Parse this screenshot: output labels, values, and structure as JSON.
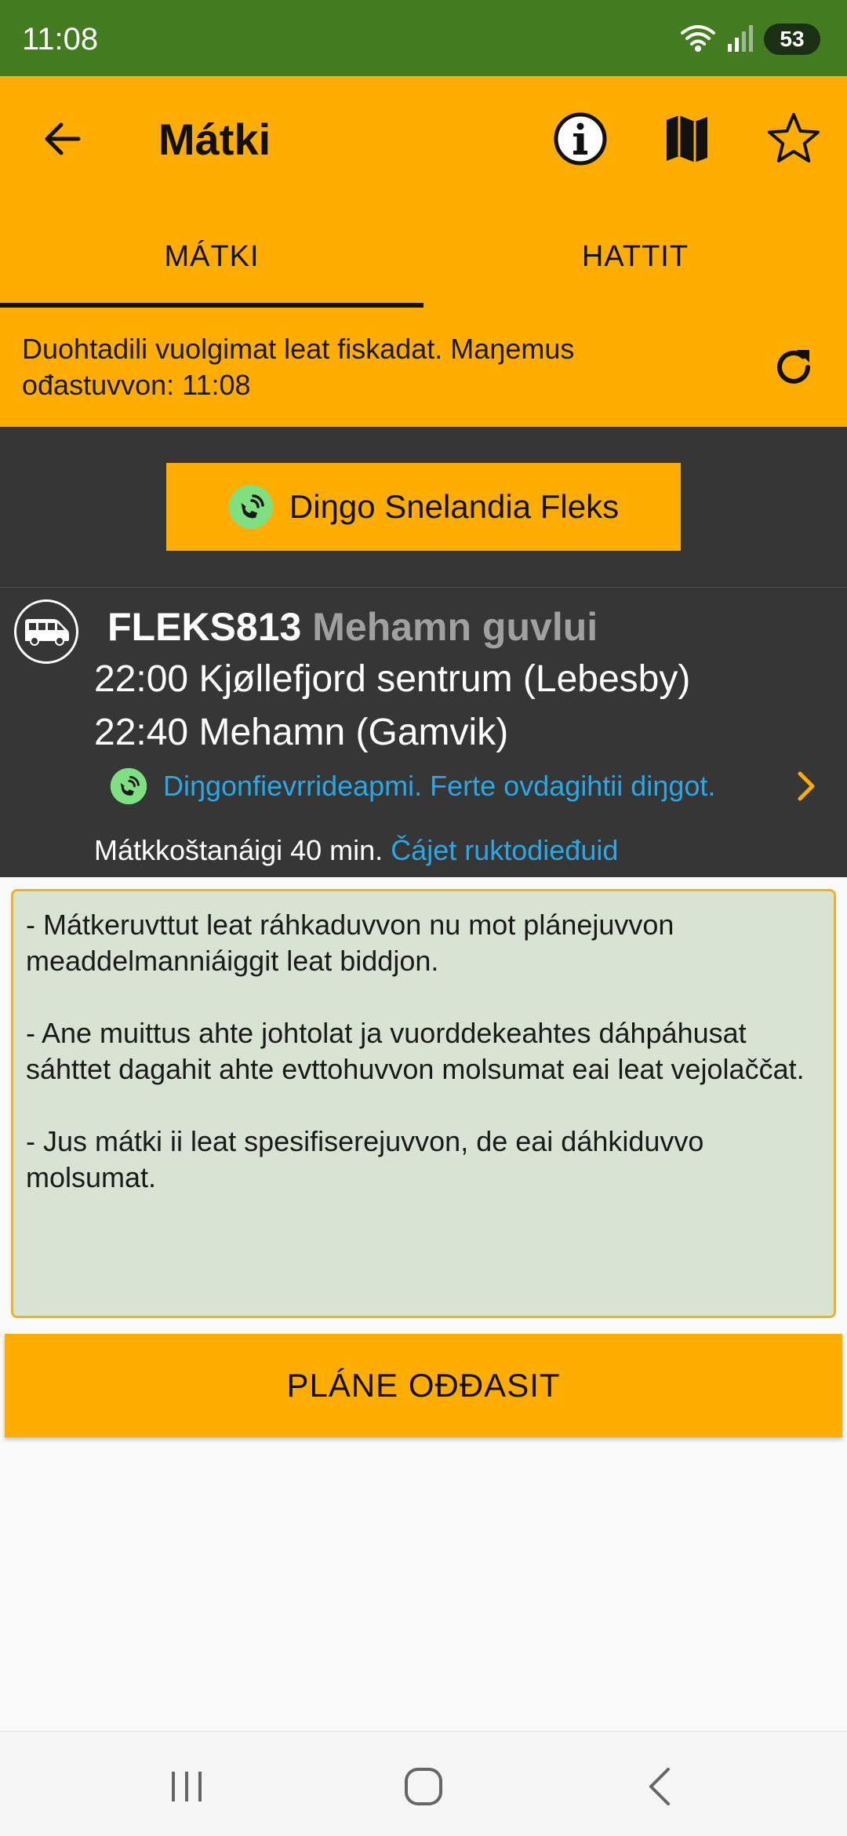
{
  "status_bar": {
    "time": "11:08",
    "battery": "53",
    "icons": [
      "wifi-icon",
      "signal-icon",
      "battery-icon"
    ]
  },
  "app_bar": {
    "title": "Mátki",
    "icons": [
      "back-arrow-icon",
      "info-icon",
      "map-icon",
      "star-icon"
    ]
  },
  "tabs": [
    {
      "label": "MÁTKI",
      "active": true
    },
    {
      "label": "HATTIT",
      "active": false
    }
  ],
  "realtime": {
    "message": "Duohtadili vuolgimat leat fiskadat. Maŋemus ođastuvvon: 11:08"
  },
  "operator": {
    "label": "Diŋgo Snelandia Fleks"
  },
  "trip": {
    "route_code": "FLEKS813",
    "destination": "Mehamn guvlui",
    "stops": [
      {
        "text": "22:00 Kjøllefjord sentrum (Lebesby)"
      },
      {
        "text": "22:40 Mehamn (Gamvik)"
      }
    ],
    "booking_text": "Diŋgonfievrrideapmi. Ferte ovdagihtii diŋgot.",
    "duration": "Mátkkoštanáigi 40 min.",
    "stops_link": "Čájet ruktodieđuid"
  },
  "info": {
    "paragraphs": [
      "- Mátkeruvttut leat ráhkaduvvon nu mot plánejuvvon meaddelmanniáiggit leat biddjon.",
      "- Ane muittus ahte johtolat ja vuorddekeahtes dáhpáhusat sáhttet dagahit ahte evttohuvvon molsumat eai leat vejolaččat.",
      "- Jus mátki ii leat spesifiserejuvvon, de eai dáhkiduvvo molsumat."
    ]
  },
  "actions": {
    "plan_return": "PLÁNE OĐĐASIT"
  },
  "colors": {
    "status_bar": "#447c22",
    "accent": "#ffad00",
    "dark_panel": "#363636",
    "link": "#29a8e8",
    "info_bg": "#d8e3d3",
    "booking_icon": "#7ee081"
  }
}
